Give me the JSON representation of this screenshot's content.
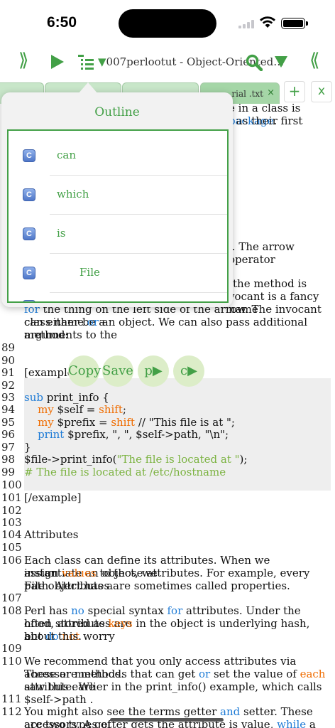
{
  "status": {
    "time": "6:50"
  },
  "toolbar": {
    "left_icon": "⟫",
    "right_icon": "⟪",
    "title_arrow": "▼",
    "title": "007perlootut - Object-Oriented…"
  },
  "tabs": [
    {
      "label": ""
    },
    {
      "label": ""
    },
    {
      "label": ""
    },
    {
      "label": ".rial .txt",
      "close": "×"
    }
  ],
  "tab_buttons": {
    "add": "+",
    "close": "x"
  },
  "outline": {
    "title": "Outline",
    "items": [
      {
        "icon": "C",
        "label": "can"
      },
      {
        "icon": "C",
        "label": "which"
      },
      {
        "icon": "C",
        "label": "is"
      },
      {
        "icon": "C",
        "label": "File"
      }
    ]
  },
  "doc": {
    "frag_1a": "e in a class is ",
    "frag_1b": "package",
    "frag_1c": ".",
    "frag_2": "t as their first",
    "frag_3": "l. The arrow operator",
    "frag_4": "the method is",
    "frag_5": "vocant is a fancy name",
    "l6_a": "for",
    "l6_b": " the thing on the left side of the arrow. The invocant can either be a",
    "l7_a": "class name ",
    "l7_b": "or",
    "l7_c": " an object. We can also pass additional arguments to the",
    "l8": "method:",
    "n89": "89",
    "n90": "90",
    "n91": "91",
    "n92": "92",
    "n93": "93",
    "n94": "94",
    "n95": "95",
    "n96": "96",
    "n97": "97",
    "n98": "98",
    "n99": "99",
    "n100": "100",
    "n101": "101",
    "n102": "102",
    "n103": "103",
    "n104": "104",
    "n105": "105",
    "n106": "106",
    "n107": "107",
    "n108": "108",
    "n109": "109",
    "n110": "110",
    "n111": "111",
    "n112": "112",
    "l91": "[example]",
    "l93_a": "sub",
    "l93_b": " print_info {",
    "l94_a": "    my",
    "l94_b": " $self = ",
    "l94_c": "shift",
    "l94_d": ";",
    "l95_a": "    my",
    "l95_b": " $prefix = ",
    "l95_c": "shift",
    "l95_d": " // \"This file is at \";",
    "l96_a": "    print",
    "l96_b": " $prefix, \", \", $self->path, \"\\n\";",
    "l97": "}",
    "l98_a": "$file->print_info(",
    "l98_b": "\"The file is located at \"",
    "l98_c": ");",
    "l99": "# The file is located at /etc/hostname",
    "l101": "[/example]",
    "l104": "Attributes",
    "l106_a": "Each class can define its attributes. When we instantiate an object, we",
    "l106_b1": "assign ",
    "l106_b2": "values",
    "l106_b3": " to those attributes. For example, every File object has a",
    "l106_c": "path. Attributes are sometimes called properties.",
    "l108_a1": "Perl has ",
    "l108_a2": "no",
    "l108_a3": " special syntax ",
    "l108_a4": "for",
    "l108_a5": " attributes. Under the hood, attributes are",
    "l108_b1": "often stored as ",
    "l108_b2": "keys",
    "l108_b3": " in the object is underlying hash, but ",
    "l108_b4": "do",
    "l108_b5": " ",
    "l108_b6": "not",
    "l108_b7": " worry",
    "l108_c": "about this.",
    "l110_a": "We recommend that you only access attributes via accessor methods.",
    "l110_b1": "These are methods that can get ",
    "l110_b2": "or",
    "l110_b3": " set the value of ",
    "l110_b4": "each",
    "l110_b5": " attribute. We",
    "l110_c": "saw this earlier in the print_info() example, which calls $self->path .",
    "l112_a1": "You might also see the terms getter ",
    "l112_a2": "and",
    "l112_a3": " setter. These are two types of",
    "l112_b1": "accessors. A getter gets the attribute is value, ",
    "l112_b2": "while",
    "l112_b3": " a setter sets it."
  },
  "actions": {
    "copy": "Copy",
    "save": "Save",
    "p": "p▶",
    "c": "c▶"
  }
}
